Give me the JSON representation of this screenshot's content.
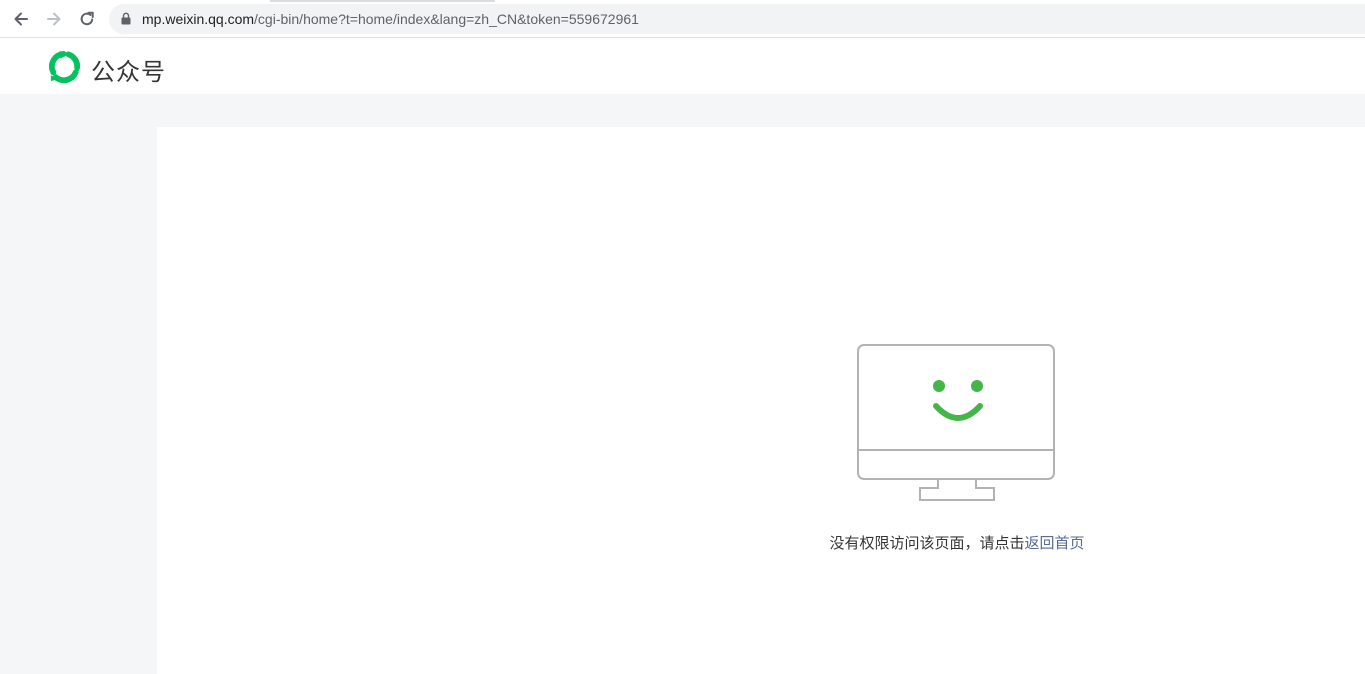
{
  "browser": {
    "url_host": "mp.weixin.qq.com",
    "url_path": "/cgi-bin/home?t=home/index&lang=zh_CN&token=559672961"
  },
  "header": {
    "logo_text": "公众号",
    "logo_icon": "wechat-mp-logo-icon",
    "accent_color": "#07c160"
  },
  "error": {
    "illustration": "monitor-smile-icon",
    "message": "没有权限访问该页面，请点击",
    "link_label": "返回首页",
    "link_color": "#576b95"
  }
}
